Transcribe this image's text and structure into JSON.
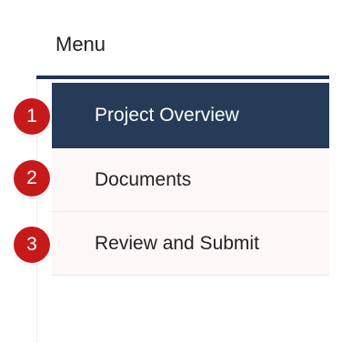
{
  "menu": {
    "title": "Menu",
    "items": [
      {
        "label": "Project Overview",
        "active": true
      },
      {
        "label": "Documents",
        "active": false
      },
      {
        "label": "Review and Submit",
        "active": false
      }
    ]
  },
  "badges": [
    "1",
    "2",
    "3"
  ],
  "colors": {
    "active_background": "#253b58",
    "header_underline": "#1e3350",
    "badge": "#c61a1a",
    "item_background": "#fcf8f8"
  }
}
